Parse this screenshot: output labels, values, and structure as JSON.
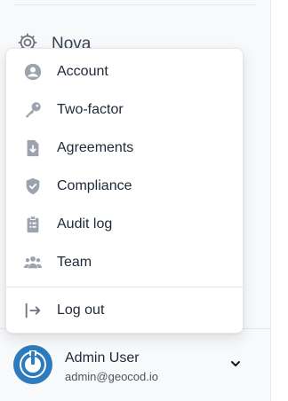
{
  "sidebar": {
    "team_item": {
      "label": "Nova",
      "icon": "gear-icon"
    }
  },
  "menu": {
    "items": [
      {
        "label": "Account",
        "icon": "user-circle-icon"
      },
      {
        "label": "Two-factor",
        "icon": "key-icon"
      },
      {
        "label": "Agreements",
        "icon": "document-download-icon"
      },
      {
        "label": "Compliance",
        "icon": "shield-check-icon"
      },
      {
        "label": "Audit log",
        "icon": "clipboard-list-icon"
      },
      {
        "label": "Team",
        "icon": "users-icon"
      }
    ],
    "logout": {
      "label": "Log out",
      "icon": "logout-arrow-icon"
    }
  },
  "user": {
    "name": "Admin User",
    "email": "admin@geocod.io",
    "avatar_color": "#2d7bbf"
  },
  "colors": {
    "icon": "#9ca3af",
    "text": "#1f2937"
  }
}
